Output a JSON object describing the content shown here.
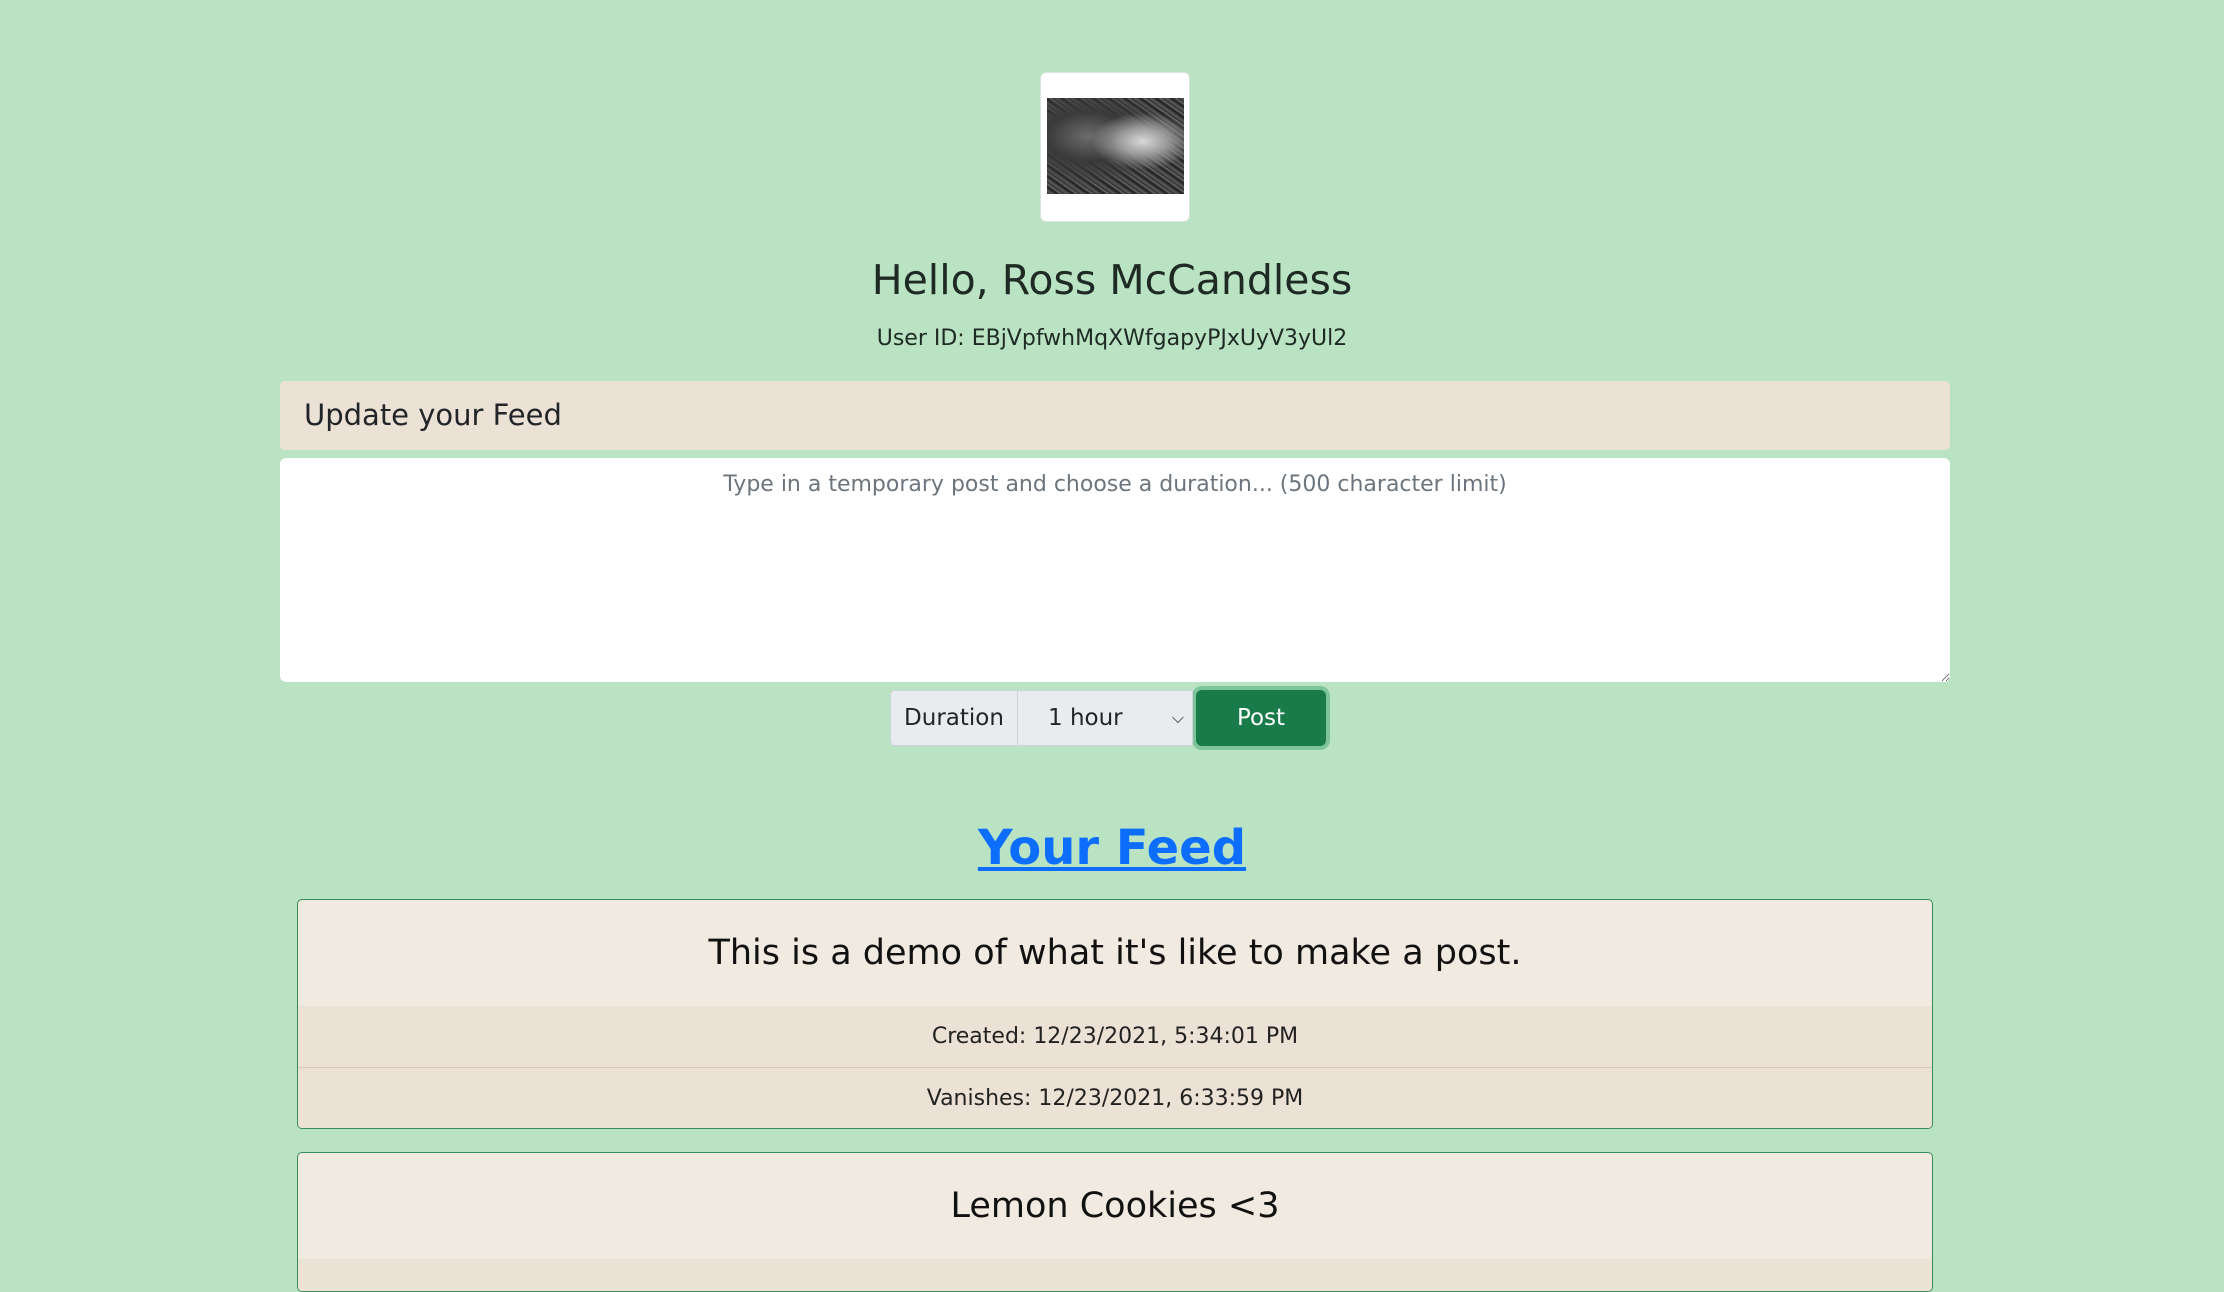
{
  "profile": {
    "greeting": "Hello, Ross McCandless",
    "user_id": "User ID: EBjVpfwhMqXWfgapyPJxUyV3yUl2"
  },
  "composer": {
    "header": "Update your Feed",
    "placeholder": "Type in a temporary post and choose a duration... (500 character limit)",
    "duration_label": "Duration",
    "duration_value": "1 hour",
    "post_label": "Post"
  },
  "feed": {
    "title": "Your Feed",
    "posts": [
      {
        "text": "This is a demo of what it's like to make a post.",
        "created": "Created: 12/23/2021, 5:34:01 PM",
        "vanishes": "Vanishes: 12/23/2021, 6:33:59 PM"
      },
      {
        "text": "Lemon Cookies <3"
      }
    ]
  },
  "colors": {
    "background": "#b9e3c3",
    "card": "#f1eae1",
    "post_button": "#197a4a",
    "link": "#0d6efd"
  }
}
